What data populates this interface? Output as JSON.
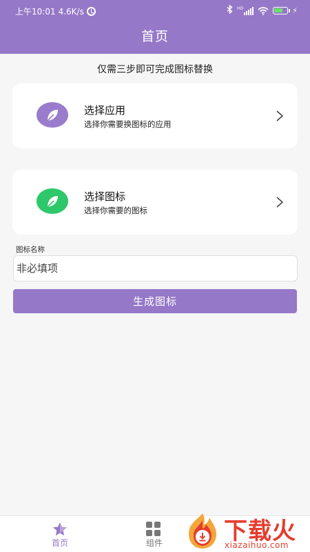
{
  "status_bar": {
    "time": "上午10:01",
    "speed": "4.6K/s",
    "network": "HD"
  },
  "header": {
    "title": "首页"
  },
  "hint": "仅需三步即可完成图标替换",
  "cards": [
    {
      "title": "选择应用",
      "subtitle": "选择你需要换图标的应用",
      "icon": "leaf-icon",
      "color": "#9a7ccc"
    },
    {
      "title": "选择图标",
      "subtitle": "选择你需要的图标",
      "icon": "leaf-icon",
      "color": "#2ec76a"
    }
  ],
  "form": {
    "label": "图标名称",
    "input_value": "",
    "input_placeholder": "非必填项",
    "button_label": "生成图标"
  },
  "nav": [
    {
      "label": "首页",
      "icon": "star-icon",
      "active": true
    },
    {
      "label": "组件",
      "icon": "grid-icon",
      "active": false
    }
  ],
  "watermark": {
    "text": "下载火",
    "url": "xiazaihuo.com"
  },
  "colors": {
    "accent": "#9678c8",
    "card_purple": "#9a7ccc",
    "card_green": "#2ec76a",
    "watermark": "#e63c2e"
  }
}
